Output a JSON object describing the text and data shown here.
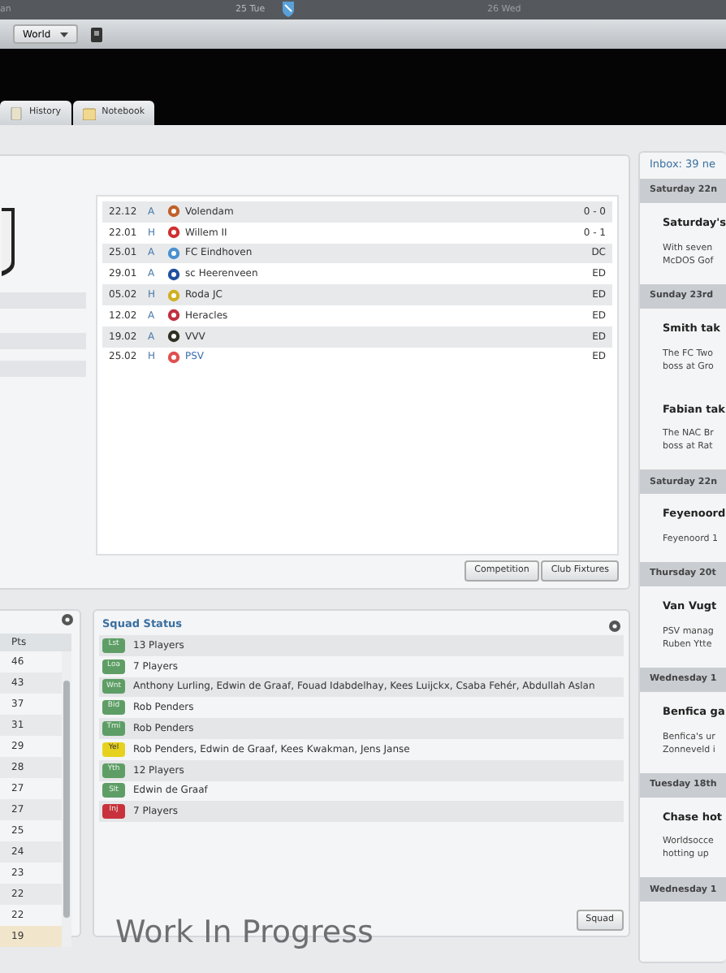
{
  "timeline": {
    "days": [
      {
        "label": "an",
        "current": false
      },
      {
        "label": "25 Tue",
        "current": true
      },
      {
        "label": "26 Wed",
        "current": false
      }
    ]
  },
  "toolbar": {
    "dropdown": "World"
  },
  "tabs": [
    {
      "label": "History",
      "selected": false
    },
    {
      "label": "Notebook",
      "selected": false
    }
  ],
  "fixtures": {
    "rows": [
      {
        "date": "22.12",
        "venue": "A",
        "team": "Volendam",
        "result": "0 - 0",
        "color": "#c0602a",
        "link": false
      },
      {
        "date": "22.01",
        "venue": "H",
        "team": "Willem II",
        "result": "0 - 1",
        "color": "#d03030",
        "link": false
      },
      {
        "date": "25.01",
        "venue": "A",
        "team": "FC Eindhoven",
        "result": "DC",
        "color": "#4a90d0",
        "link": false
      },
      {
        "date": "29.01",
        "venue": "A",
        "team": "sc Heerenveen",
        "result": "ED",
        "color": "#2050a0",
        "link": false
      },
      {
        "date": "05.02",
        "venue": "H",
        "team": "Roda JC",
        "result": "ED",
        "color": "#d0b020",
        "link": false
      },
      {
        "date": "12.02",
        "venue": "A",
        "team": "Heracles",
        "result": "ED",
        "color": "#c03040",
        "link": false
      },
      {
        "date": "19.02",
        "venue": "A",
        "team": "VVV",
        "result": "ED",
        "color": "#303020",
        "link": false
      },
      {
        "date": "25.02",
        "venue": "H",
        "team": "PSV",
        "result": "ED",
        "color": "#e05050",
        "link": true
      }
    ],
    "buttons": [
      "Competition",
      "Club Fixtures"
    ]
  },
  "table": {
    "column": "Pts",
    "rows": [
      {
        "value": "46",
        "selected": false
      },
      {
        "value": "43",
        "selected": false
      },
      {
        "value": "37",
        "selected": false
      },
      {
        "value": "31",
        "selected": false
      },
      {
        "value": "29",
        "selected": false
      },
      {
        "value": "28",
        "selected": false
      },
      {
        "value": "27",
        "selected": false
      },
      {
        "value": "27",
        "selected": false
      },
      {
        "value": "25",
        "selected": false
      },
      {
        "value": "24",
        "selected": false
      },
      {
        "value": "23",
        "selected": false
      },
      {
        "value": "22",
        "selected": false
      },
      {
        "value": "22",
        "selected": false
      },
      {
        "value": "19",
        "selected": true
      }
    ]
  },
  "squad_status": {
    "title": "Squad Status",
    "rows": [
      {
        "tag": "Lst",
        "text": "13 Players",
        "color": "#5e9e66"
      },
      {
        "tag": "Loa",
        "text": "7 Players",
        "color": "#5e9e66"
      },
      {
        "tag": "Wnt",
        "text": "Anthony Lurling, Edwin de Graaf, Fouad Idabdelhay, Kees Luijckx, Csaba Fehér, Abdullah Aslan",
        "color": "#5e9e66"
      },
      {
        "tag": "Bid",
        "text": "Rob Penders",
        "color": "#5e9e66"
      },
      {
        "tag": "Tmi",
        "text": "Rob Penders",
        "color": "#5e9e66"
      },
      {
        "tag": "Yel",
        "text": "Rob Penders, Edwin de Graaf, Kees Kwakman, Jens Janse",
        "color": "#e6d21e"
      },
      {
        "tag": "Yth",
        "text": "12 Players",
        "color": "#5e9e66"
      },
      {
        "tag": "Slt",
        "text": "Edwin de Graaf",
        "color": "#5e9e66"
      },
      {
        "tag": "Inj",
        "text": "7 Players",
        "color": "#c8323c"
      }
    ],
    "button": "Squad"
  },
  "caption": "Work In Progress",
  "inbox": {
    "title": "Inbox: 39 ne",
    "groups": [
      {
        "date": "Saturday 22n",
        "items": [
          {
            "title": "Saturday's",
            "lines": [
              "With seven",
              "McDOS Gof"
            ]
          }
        ]
      },
      {
        "date": "Sunday 23rd",
        "items": [
          {
            "title": "Smith tak",
            "lines": [
              "The FC Two",
              "boss at Gro"
            ]
          },
          {
            "title": "Fabian tak",
            "lines": [
              "The NAC Br",
              "boss at Rat"
            ]
          }
        ]
      },
      {
        "date": "Saturday 22n",
        "items": [
          {
            "title": "Feyenoord",
            "lines": [
              "Feyenoord 1"
            ]
          }
        ]
      },
      {
        "date": "Thursday 20t",
        "items": [
          {
            "title": "Van Vugt",
            "lines": [
              "PSV manag",
              "Ruben Ytte"
            ]
          }
        ]
      },
      {
        "date": "Wednesday 1",
        "items": [
          {
            "title": "Benfica ga",
            "lines": [
              "Benfica's ur",
              "Zonneveld i"
            ]
          }
        ]
      },
      {
        "date": "Tuesday 18th",
        "items": [
          {
            "title": "Chase hot",
            "lines": [
              "Worldsocce",
              "hotting up"
            ]
          }
        ]
      },
      {
        "date": "Wednesday 1"
      }
    ]
  }
}
